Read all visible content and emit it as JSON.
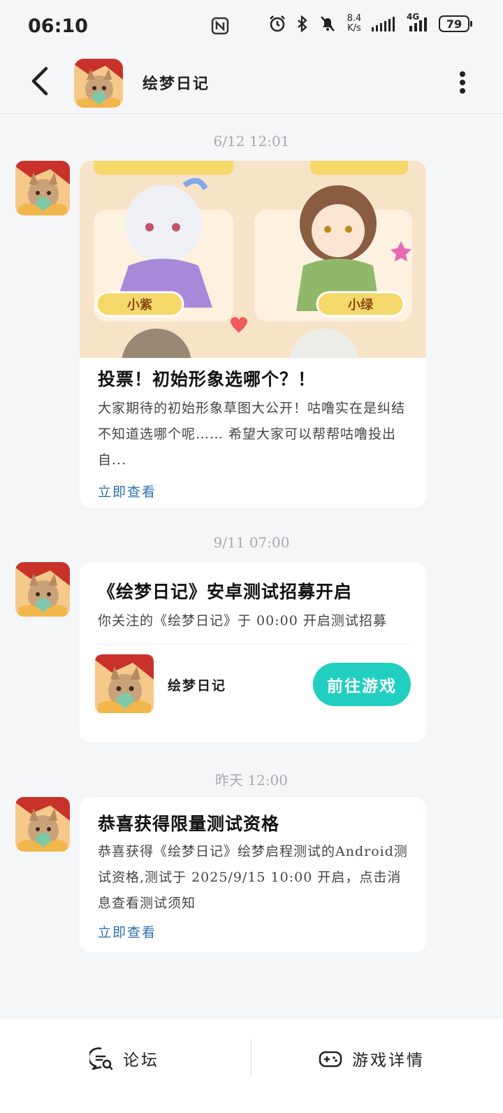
{
  "status_bar": {
    "time": "06:10",
    "net_speed_value": "8.4",
    "net_speed_unit": "K/s",
    "network_type": "4G",
    "battery": "79"
  },
  "header": {
    "title": "绘梦日记"
  },
  "messages": [
    {
      "timestamp": "6/12  12:01",
      "title": "投票！初始形象选哪个？！",
      "body": "大家期待的初始形象草图大公开！咕噜实在是纠结不知道选哪个呢…… 希望大家可以帮帮咕噜投出自...",
      "link": "立即查看",
      "image_labels": [
        "小紫",
        "小绿"
      ]
    },
    {
      "timestamp": "9/11  07:00",
      "title": "《绘梦日记》安卓测试招募开启",
      "body": "你关注的《绘梦日记》于 00:00 开启测试招募",
      "game_name": "绘梦日记",
      "button": "前往游戏"
    },
    {
      "timestamp": "昨天  12:00",
      "title": "恭喜获得限量测试资格",
      "body": "恭喜获得《绘梦日记》绘梦启程测试的Android测试资格,测试于 2025/9/15 10:00 开启，点击消息查看测试须知",
      "link": "立即查看"
    }
  ],
  "bottom_nav": {
    "forum": "论坛",
    "game_details": "游戏详情"
  },
  "colors": {
    "accent_button": "#21cfc0",
    "link": "#2a6fb0",
    "background": "#f5f6f8"
  }
}
